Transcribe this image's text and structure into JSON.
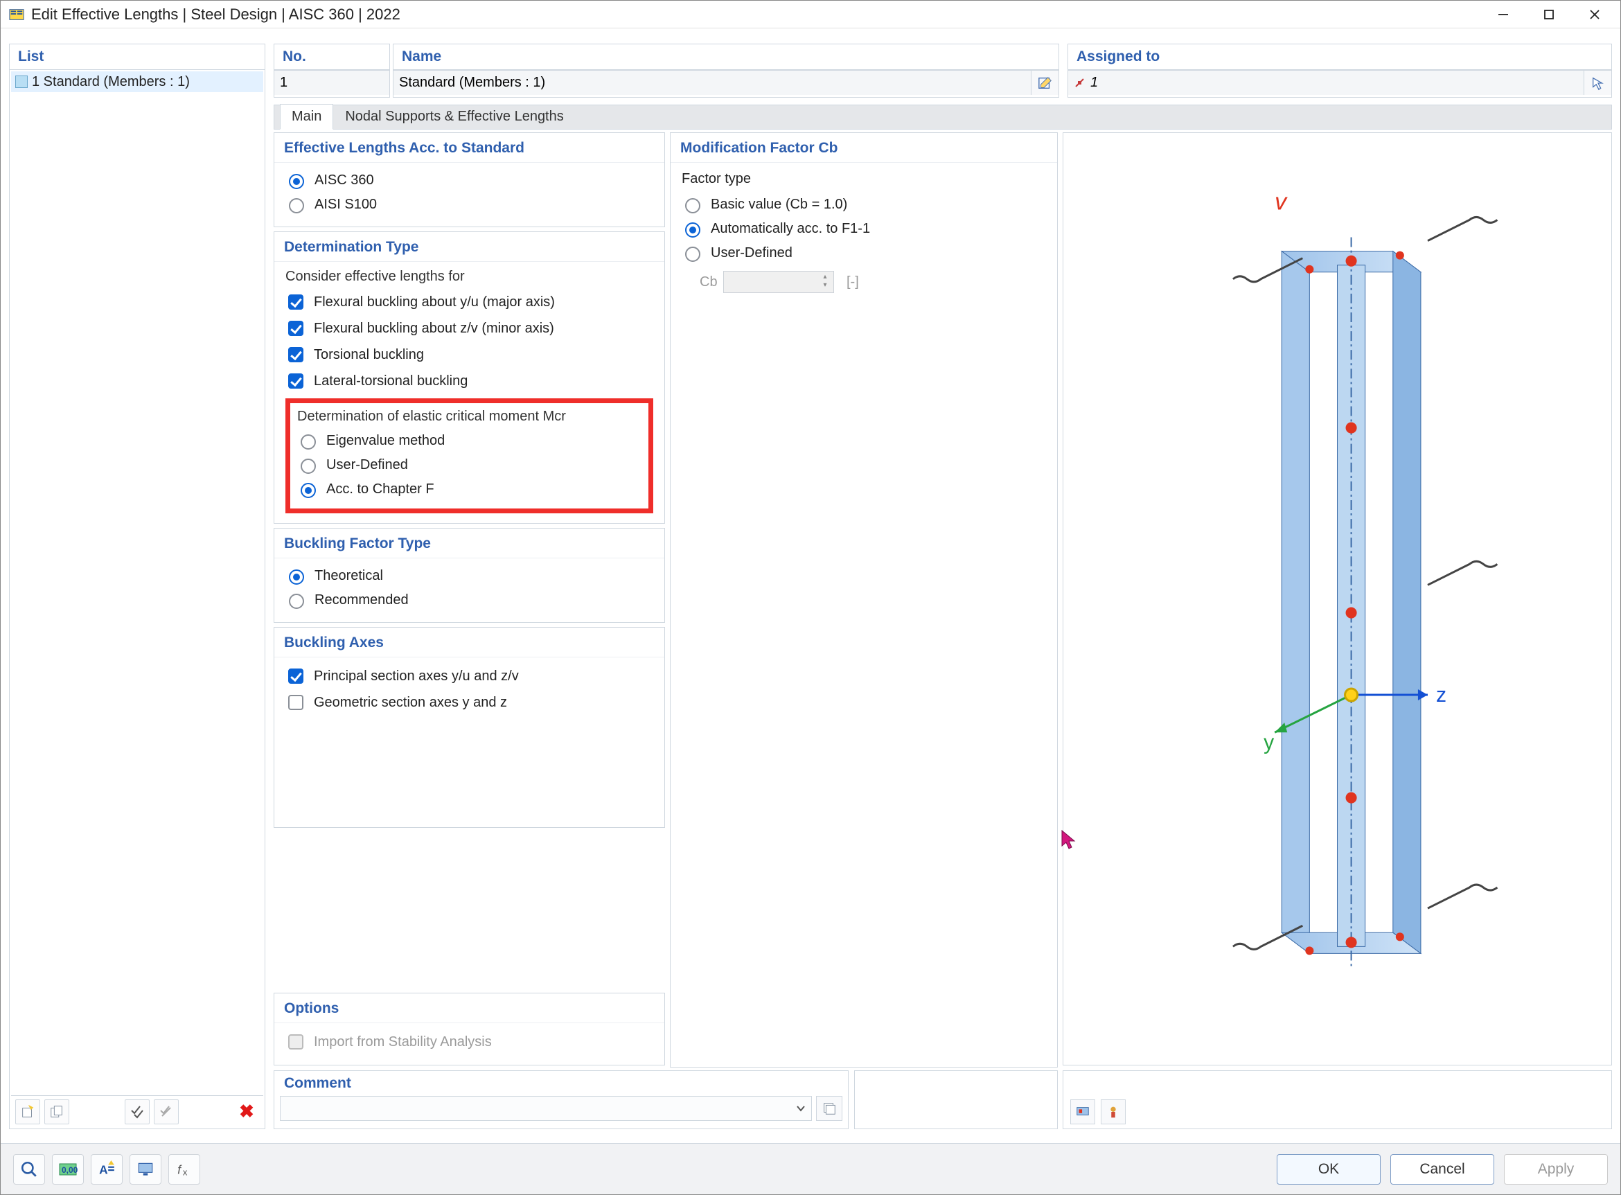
{
  "window": {
    "title": "Edit Effective Lengths | Steel Design | AISC 360 | 2022"
  },
  "panels": {
    "list_header": "List",
    "no_header": "No.",
    "name_header": "Name",
    "assigned_header": "Assigned to"
  },
  "list": {
    "items": [
      {
        "label": "1 Standard (Members : 1)"
      }
    ]
  },
  "no_field": "1",
  "name_field": "Standard (Members : 1)",
  "assigned_field": "1",
  "tabs": [
    {
      "label": "Main",
      "active": true
    },
    {
      "label": "Nodal Supports & Effective Lengths",
      "active": false
    }
  ],
  "effective_lengths": {
    "title": "Effective Lengths Acc. to Standard",
    "options": [
      {
        "label": "AISC 360",
        "selected": true
      },
      {
        "label": "AISI S100",
        "selected": false
      }
    ]
  },
  "determination_type": {
    "title": "Determination Type",
    "consider_label": "Consider effective lengths for",
    "checks": [
      {
        "label": "Flexural buckling about y/u (major axis)",
        "checked": true
      },
      {
        "label": "Flexural buckling about z/v (minor axis)",
        "checked": true
      },
      {
        "label": "Torsional buckling",
        "checked": true
      },
      {
        "label": "Lateral-torsional buckling",
        "checked": true
      }
    ],
    "mcr_label": "Determination of elastic critical moment Mcr",
    "mcr_options": [
      {
        "label": "Eigenvalue method",
        "selected": false
      },
      {
        "label": "User-Defined",
        "selected": false
      },
      {
        "label": "Acc. to Chapter F",
        "selected": true
      }
    ]
  },
  "buckling_factor": {
    "title": "Buckling Factor Type",
    "options": [
      {
        "label": "Theoretical",
        "selected": true
      },
      {
        "label": "Recommended",
        "selected": false
      }
    ]
  },
  "buckling_axes": {
    "title": "Buckling Axes",
    "checks": [
      {
        "label": "Principal section axes y/u and z/v",
        "checked": true
      },
      {
        "label": "Geometric section axes y and z",
        "checked": false
      }
    ]
  },
  "options": {
    "title": "Options",
    "import_label": "Import from Stability Analysis"
  },
  "modification_factor": {
    "title": "Modification Factor Cb",
    "factor_type_label": "Factor type",
    "options": [
      {
        "label": "Basic value (Cb = 1.0)",
        "selected": false
      },
      {
        "label": "Automatically acc. to F1-1",
        "selected": true
      },
      {
        "label": "User-Defined",
        "selected": false
      }
    ],
    "cb_label": "Cb",
    "cb_unit": "[-]"
  },
  "comment": {
    "title": "Comment",
    "value": ""
  },
  "buttons": {
    "ok": "OK",
    "cancel": "Cancel",
    "apply": "Apply"
  },
  "axis_labels": {
    "v": "v",
    "y": "y",
    "z": "z"
  }
}
